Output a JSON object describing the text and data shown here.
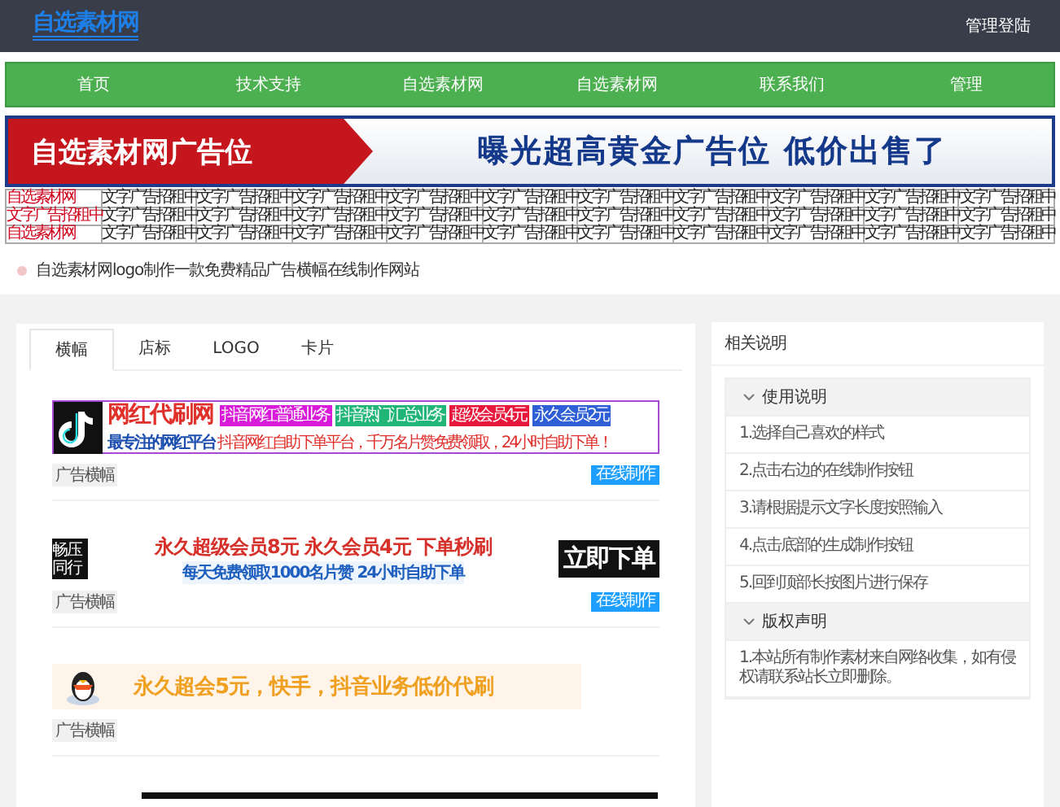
{
  "header": {
    "logo": "自选素材网",
    "login": "管理登陆"
  },
  "nav": [
    "首页",
    "技术支持",
    "自选素材网",
    "自选素材网",
    "联系我们",
    "管理"
  ],
  "top_banner": {
    "left": "自选素材网广告位",
    "right": "曝光超高黄金广告位 低价出售了"
  },
  "text_ads": {
    "rows": [
      [
        "自选素材网",
        "文字广告招租中",
        "文字广告招租中",
        "文字广告招租中",
        "文字广告招租中",
        "文字广告招租中",
        "文字广告招租中",
        "文字广告招租中",
        "文字广告招租中",
        "文字广告招租中",
        "文字广告招租中"
      ],
      [
        "文字广告招租中",
        "文字广告招租中",
        "文字广告招租中",
        "文字广告招租中",
        "文字广告招租中",
        "文字广告招租中",
        "文字广告招租中",
        "文字广告招租中",
        "文字广告招租中",
        "文字广告招租中",
        "文字广告招租中"
      ],
      [
        "自选素材网",
        "文字广告招租中",
        "文字广告招租中",
        "文字广告招租中",
        "文字广告招租中",
        "文字广告招租中",
        "文字广告招租中",
        "文字广告招租中",
        "文字广告招租中",
        "文字广告招租中",
        "文字广告招租中"
      ]
    ]
  },
  "notice": "自选素材网logo制作一款免费精品广告横幅在线制作网站",
  "tabs": [
    {
      "label": "横幅",
      "selected": true
    },
    {
      "label": "店标",
      "selected": false
    },
    {
      "label": "LOGO",
      "selected": false
    },
    {
      "label": "卡片",
      "selected": false
    }
  ],
  "templates": [
    {
      "kind": "douyin",
      "title": "网红代刷网",
      "subtitle": "最专注的网红平台",
      "tags": [
        {
          "text": "抖音网红普通业务",
          "color": "#d81bd8"
        },
        {
          "text": "抖音热门汇总业务",
          "color": "#21b677"
        },
        {
          "text": "超级会员4元",
          "color": "#e8173c"
        },
        {
          "text": "永久会员2元",
          "color": "#2f5fd6"
        }
      ],
      "slogan": "抖音网红自助下单平台，千万名片赞免费领取，24小时自助下单！",
      "tag": "广告横幅",
      "button": "在线制作"
    },
    {
      "kind": "promo",
      "badge": "畅压同行",
      "line1": "永久超级会员8元  永久会员4元  下单秒刷",
      "line2": "每天免费领取1000名片赞  24小时自助下单",
      "action": "立即下单",
      "tag": "广告横幅",
      "button": "在线制作"
    },
    {
      "kind": "qq",
      "line1": "永久超会5元，快手，抖音业务低价代刷",
      "tag": "广告横幅"
    },
    {
      "kind": "cut"
    }
  ],
  "sidebar": {
    "title": "相关说明",
    "sections": [
      {
        "title": "使用说明",
        "expanded": true,
        "items": [
          "1.选择自己喜欢的样式",
          "2.点击右边的在线制作按钮",
          "3.请根据提示文字长度按照输入",
          "4.点击底部的生成制作按钮",
          "5.回到顶部长按图片进行保存"
        ]
      },
      {
        "title": "版权声明",
        "expanded": true,
        "items": [
          "1.本站所有制作素材来自网络收集，如有侵权请联系站长立即删除。"
        ]
      }
    ]
  }
}
